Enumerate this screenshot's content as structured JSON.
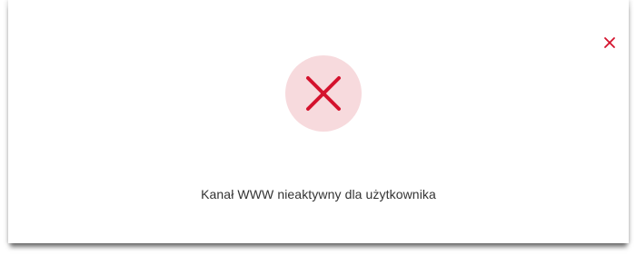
{
  "dialog": {
    "close_icon": "close-icon",
    "status_icon": "error-x-icon",
    "message": "Kanał WWW nieaktywny dla użytkownika"
  },
  "colors": {
    "accent_red": "#d4122d",
    "circle_bg": "#f7dadd",
    "text": "#333333"
  }
}
